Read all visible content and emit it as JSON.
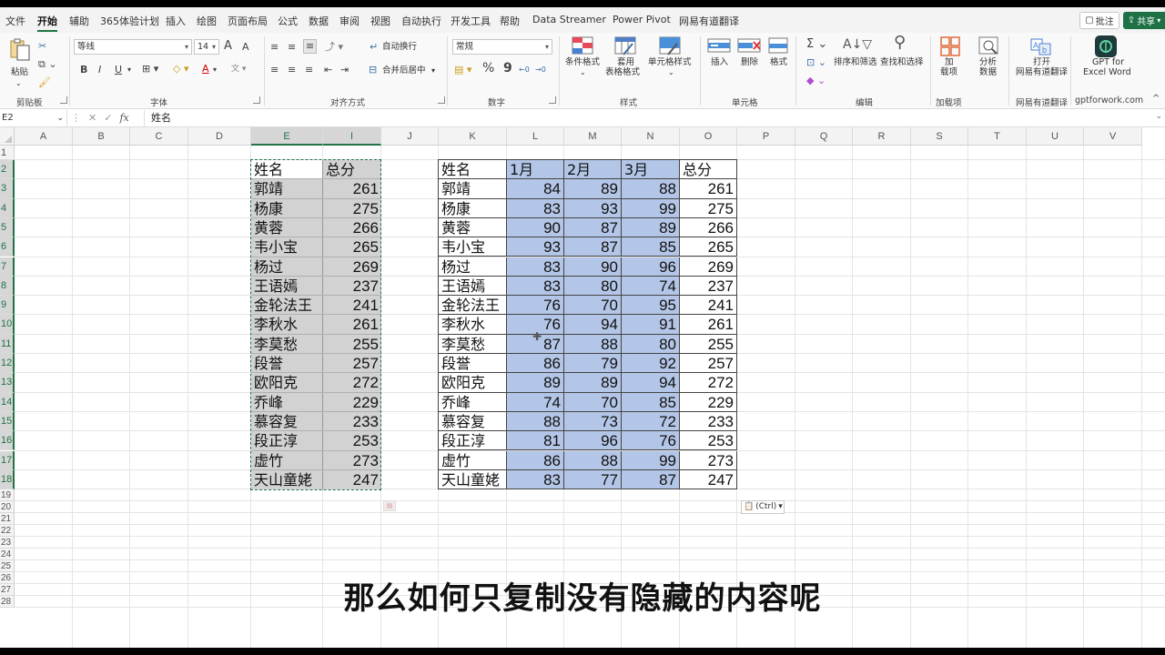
{
  "tabs": [
    {
      "label": "文件",
      "active": false
    },
    {
      "label": "开始",
      "active": true
    },
    {
      "label": "辅助",
      "active": false
    },
    {
      "label": "365体验计划",
      "active": false
    },
    {
      "label": "插入",
      "active": false
    },
    {
      "label": "绘图",
      "active": false
    },
    {
      "label": "页面布局",
      "active": false
    },
    {
      "label": "公式",
      "active": false
    },
    {
      "label": "数据",
      "active": false
    },
    {
      "label": "审阅",
      "active": false
    },
    {
      "label": "视图",
      "active": false
    },
    {
      "label": "自动执行",
      "active": false
    },
    {
      "label": "开发工具",
      "active": false
    },
    {
      "label": "帮助",
      "active": false
    },
    {
      "label": "Data Streamer",
      "active": false
    },
    {
      "label": "Power Pivot",
      "active": false
    },
    {
      "label": "网易有道翻译",
      "active": false
    }
  ],
  "header_buttons": {
    "comment": "批注",
    "share": "共享"
  },
  "ribbon": {
    "clipboard": {
      "paste": "粘贴",
      "group": "剪贴板"
    },
    "font": {
      "name": "等线",
      "size": "14",
      "group": "字体",
      "bold": "B",
      "italic": "I",
      "underline": "U",
      "grow": "A",
      "shrink": "A"
    },
    "alignment": {
      "wrap": "自动换行",
      "merge": "合并后居中",
      "group": "对齐方式"
    },
    "number": {
      "format": "常规",
      "percent": "%",
      "comma": "9",
      "group": "数字"
    },
    "styles": {
      "conditional": "条件格式",
      "table_line1": "套用",
      "table_line2": "表格格式",
      "cell_styles": "单元格样式",
      "group": "样式"
    },
    "cells": {
      "insert": "插入",
      "delete": "删除",
      "format": "格式",
      "group": "单元格"
    },
    "editing": {
      "sort": "排序和筛选",
      "find": "查找和选择",
      "group": "编辑"
    },
    "addins": {
      "line1": "加",
      "line2": "载项",
      "group": "加载项"
    },
    "analyze": {
      "line1": "分析",
      "line2": "数据"
    },
    "youdao": {
      "line1": "打开",
      "line2": "网易有道翻译",
      "group": "网易有道翻译"
    },
    "gpt": {
      "line1": "GPT for",
      "line2": "Excel Word",
      "group": "gptforwork.com"
    }
  },
  "formula_bar": {
    "name_box": "E2",
    "fx": "fx",
    "value": "姓名"
  },
  "columns": [
    "A",
    "B",
    "C",
    "D",
    "E",
    "I",
    "J",
    "K",
    "L",
    "M",
    "N",
    "O",
    "P",
    "Q",
    "R",
    "S",
    "T",
    "U",
    "V"
  ],
  "rows": [
    "1",
    "2",
    "3",
    "4",
    "5",
    "6",
    "7",
    "8",
    "9",
    "10",
    "11",
    "12",
    "13",
    "14",
    "15",
    "16",
    "17",
    "18",
    "19",
    "20",
    "21",
    "22",
    "23",
    "24",
    "25",
    "26",
    "27",
    "28"
  ],
  "left_table": {
    "headers": [
      "姓名",
      "总分"
    ],
    "rows": [
      [
        "郭靖",
        "261"
      ],
      [
        "杨康",
        "275"
      ],
      [
        "黄蓉",
        "266"
      ],
      [
        "韦小宝",
        "265"
      ],
      [
        "杨过",
        "269"
      ],
      [
        "王语嫣",
        "237"
      ],
      [
        "金轮法王",
        "241"
      ],
      [
        "李秋水",
        "261"
      ],
      [
        "李莫愁",
        "255"
      ],
      [
        "段誉",
        "257"
      ],
      [
        "欧阳克",
        "272"
      ],
      [
        "乔峰",
        "229"
      ],
      [
        "慕容复",
        "233"
      ],
      [
        "段正淳",
        "253"
      ],
      [
        "虚竹",
        "273"
      ],
      [
        "天山童姥",
        "247"
      ]
    ]
  },
  "right_table": {
    "headers": [
      "姓名",
      "1月",
      "2月",
      "3月",
      "总分"
    ],
    "rows": [
      [
        "郭靖",
        "84",
        "89",
        "88",
        "261"
      ],
      [
        "杨康",
        "83",
        "93",
        "99",
        "275"
      ],
      [
        "黄蓉",
        "90",
        "87",
        "89",
        "266"
      ],
      [
        "韦小宝",
        "93",
        "87",
        "85",
        "265"
      ],
      [
        "杨过",
        "83",
        "90",
        "96",
        "269"
      ],
      [
        "王语嫣",
        "83",
        "80",
        "74",
        "237"
      ],
      [
        "金轮法王",
        "76",
        "70",
        "95",
        "241"
      ],
      [
        "李秋水",
        "76",
        "94",
        "91",
        "261"
      ],
      [
        "李莫愁",
        "87",
        "88",
        "80",
        "255"
      ],
      [
        "段誉",
        "86",
        "79",
        "92",
        "257"
      ],
      [
        "欧阳克",
        "89",
        "89",
        "94",
        "272"
      ],
      [
        "乔峰",
        "74",
        "70",
        "85",
        "229"
      ],
      [
        "慕容复",
        "88",
        "73",
        "72",
        "233"
      ],
      [
        "段正淳",
        "81",
        "96",
        "76",
        "253"
      ],
      [
        "虚竹",
        "86",
        "88",
        "99",
        "273"
      ],
      [
        "天山童姥",
        "83",
        "77",
        "87",
        "247"
      ]
    ]
  },
  "paste_options": "(Ctrl)",
  "subtitle": "那么如何只复制没有隐藏的内容呢",
  "colors": {
    "accent": "#217346",
    "selection_blue": "#b4c6e7",
    "copied_gray": "#d2d2d2"
  }
}
